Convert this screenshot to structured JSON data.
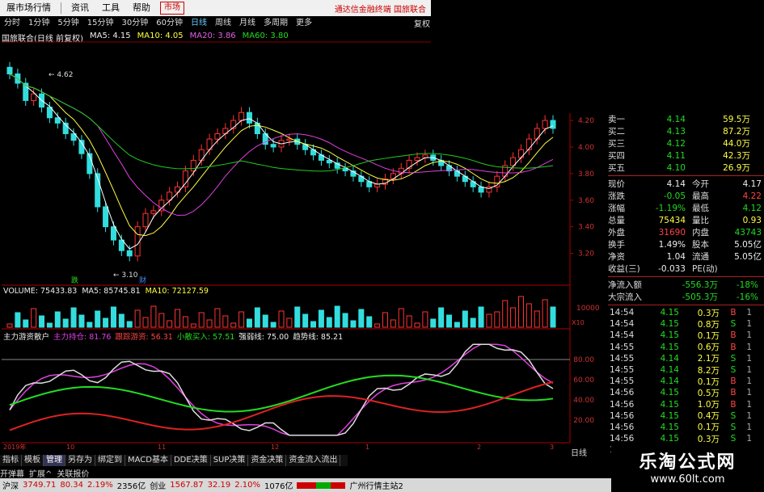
{
  "menubar": {
    "items": [
      "展市场行情",
      "资讯",
      "工具",
      "帮助"
    ],
    "market": "市场",
    "brand": "通达信金融终端  国旅联合"
  },
  "periods": [
    "分时",
    "1分钟",
    "5分钟",
    "15分钟",
    "30分钟",
    "60分钟",
    "日线",
    "周线",
    "月线",
    "多周期",
    "更多"
  ],
  "active_period": "日线",
  "restore_label": "复权",
  "title": {
    "name": "国旅联合(日线 前复权)",
    "ma5": "MA5: 4.15",
    "ma10": "MA10: 4.05",
    "ma20": "MA20: 3.86",
    "ma60": "MA60: 3.80"
  },
  "price_axis": [
    "4.20",
    "4.00",
    "3.80",
    "3.60",
    "3.40",
    "3.20"
  ],
  "annotations": {
    "high": "4.62",
    "low": "3.10",
    "label_a": "跌",
    "label_b": "财"
  },
  "volume": {
    "label": "VOLUME: 75433.83",
    "ma5": "MA5: 85745.81",
    "ma10": "MA10: 72127.59",
    "axis_top": "10000",
    "axis_unit": "X10"
  },
  "indicator": {
    "name": "主力游资散户",
    "v1": "主力持仓: 81.76",
    "v2": "跟踪游资: 56.31",
    "v3": "小散买入: 57.51",
    "v4": "强弱线: 75.00",
    "v5": "趋势线: 85.21",
    "axis": [
      "80.00",
      "60.00",
      "40.00",
      "20.00"
    ]
  },
  "xaxis_dates": [
    "2019年",
    "10",
    "11",
    "12",
    "1",
    "2",
    "3"
  ],
  "right_panel": {
    "asks": [
      [
        "卖一",
        "4.14",
        "59.5万"
      ],
      [
        "买二",
        "4.13",
        "87.2万"
      ],
      [
        "买三",
        "4.12",
        "44.0万"
      ],
      [
        "买四",
        "4.11",
        "42.3万"
      ],
      [
        "买五",
        "4.10",
        "26.9万"
      ]
    ],
    "quote": [
      [
        "现价",
        "4.14",
        "今开",
        "4.17"
      ],
      [
        "涨跌",
        "-0.05",
        "最高",
        "4.22"
      ],
      [
        "涨幅",
        "-1.19%",
        "最低",
        "4.12"
      ],
      [
        "总量",
        "75434",
        "量比",
        "0.93"
      ],
      [
        "外盘",
        "31690",
        "内盘",
        "43743"
      ],
      [
        "换手",
        "1.49%",
        "股本",
        "5.05亿"
      ],
      [
        "净资",
        "1.04",
        "流通",
        "5.05亿"
      ],
      [
        "收益(三)",
        "-0.033",
        "PE(动)",
        ""
      ]
    ],
    "flows": [
      [
        "净流入额",
        "-556.3万",
        "-18%"
      ],
      [
        "大宗流入",
        "-505.3万",
        "-16%"
      ]
    ],
    "ticks": [
      [
        "14:54",
        "4.15",
        "0.3万",
        "B",
        "1"
      ],
      [
        "14:54",
        "4.15",
        "0.8万",
        "S",
        "1"
      ],
      [
        "14:54",
        "4.15",
        "0.1万",
        "B",
        "1"
      ],
      [
        "14:55",
        "4.15",
        "0.6万",
        "B",
        "1"
      ],
      [
        "14:55",
        "4.14",
        "2.1万",
        "S",
        "1"
      ],
      [
        "14:55",
        "4.14",
        "8.2万",
        "S",
        "1"
      ],
      [
        "14:55",
        "4.14",
        "0.1万",
        "B",
        "1"
      ],
      [
        "14:56",
        "4.15",
        "0.5万",
        "B",
        "1"
      ],
      [
        "14:56",
        "4.15",
        "1.0万",
        "B",
        "1"
      ],
      [
        "14:56",
        "4.15",
        "0.4万",
        "S",
        "1"
      ],
      [
        "14:56",
        "4.15",
        "0.1万",
        "S",
        "1"
      ],
      [
        "14:56",
        "4.15",
        "0.3万",
        "S",
        "1"
      ],
      [
        "14:56",
        "4.14",
        "20.7万",
        "S",
        "1"
      ]
    ],
    "tab": "日线"
  },
  "bottom_tabs": [
    "指标",
    "模板",
    "管理",
    "另存为",
    "绑定到",
    "MACD基本",
    "DDE决策",
    "SUP决策",
    "资金决策",
    "资金流入流出"
  ],
  "active_tab": "管理",
  "bottom_row2": [
    "开弹幕",
    "扩展^",
    "关联报价"
  ],
  "status": {
    "sh_label": "沪深",
    "sh_val": "3749.71",
    "sh_chg": "80.34",
    "sh_pct": "2.19%",
    "sh_amt": "2356亿",
    "cy_label": "创业",
    "cy_val": "1567.87",
    "cy_chg": "32.19",
    "cy_pct": "2.10%",
    "cy_amt": "1076亿",
    "server": "广州行情主站2"
  },
  "watermark": {
    "line1": "乐淘公式网",
    "line2": "www.60lt.com"
  },
  "chart_data": {
    "type": "candlestick",
    "title": "国旅联合(日线 前复权)",
    "ylim": [
      3.1,
      4.62
    ],
    "y_ticks": [
      3.2,
      3.4,
      3.6,
      3.8,
      4.0,
      4.2
    ],
    "x_labels": [
      "2019年",
      "10",
      "11",
      "12",
      "1",
      "2",
      "3"
    ],
    "series": [
      {
        "name": "MA5",
        "value": 4.15
      },
      {
        "name": "MA10",
        "value": 4.05
      },
      {
        "name": "MA20",
        "value": 3.86
      },
      {
        "name": "MA60",
        "value": 3.8
      }
    ],
    "close": [
      4.55,
      4.48,
      4.35,
      4.4,
      4.3,
      4.22,
      4.18,
      4.1,
      4.05,
      3.95,
      3.8,
      3.55,
      3.4,
      3.3,
      3.22,
      3.18,
      3.4,
      3.5,
      3.52,
      3.6,
      3.66,
      3.7,
      3.82,
      3.9,
      3.98,
      4.06,
      4.1,
      4.14,
      4.2,
      4.26,
      4.18,
      4.1,
      4.02,
      4.0,
      4.05,
      4.06,
      4.02,
      3.98,
      3.94,
      3.9,
      3.88,
      3.84,
      3.82,
      3.78,
      3.74,
      3.7,
      3.72,
      3.76,
      3.8,
      3.84,
      3.9,
      3.92,
      3.94,
      3.9,
      3.86,
      3.82,
      3.78,
      3.74,
      3.7,
      3.66,
      3.7,
      3.78,
      3.86,
      3.92,
      3.98,
      4.06,
      4.14,
      4.2,
      4.14
    ],
    "high": 4.62,
    "low": 3.1
  }
}
